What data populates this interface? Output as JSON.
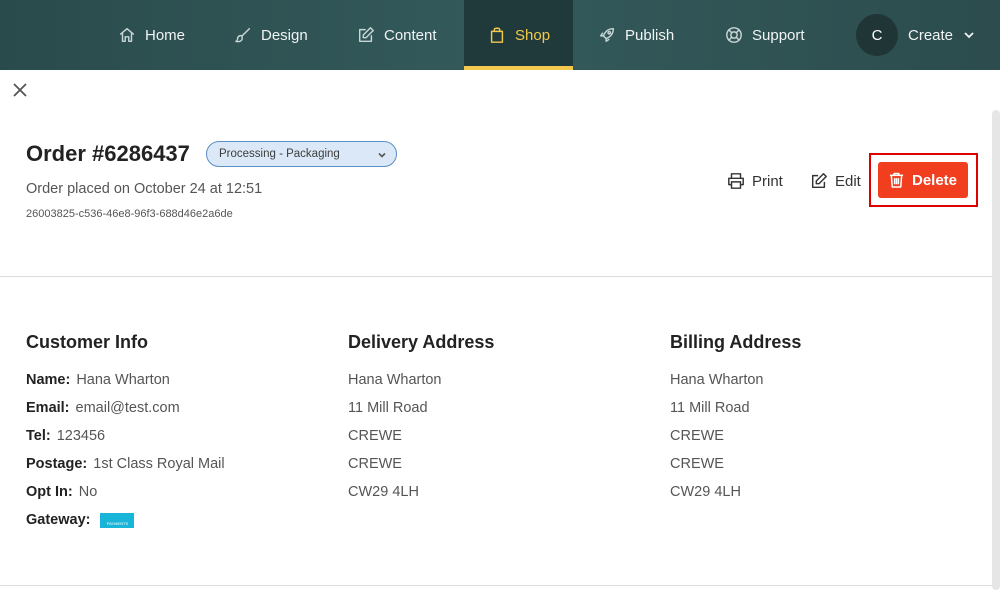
{
  "nav": {
    "items": [
      {
        "label": "Home",
        "icon": "home-icon"
      },
      {
        "label": "Design",
        "icon": "brush-icon"
      },
      {
        "label": "Content",
        "icon": "edit-icon"
      },
      {
        "label": "Shop",
        "icon": "shopping-bag-icon",
        "active": true
      },
      {
        "label": "Publish",
        "icon": "rocket-icon"
      },
      {
        "label": "Support",
        "icon": "lifebuoy-icon"
      }
    ],
    "avatar_initial": "C",
    "create_label": "Create"
  },
  "order": {
    "title": "Order #6286437",
    "status": "Processing - Packaging",
    "placed": "Order placed on October 24 at 12:51",
    "uuid": "26003825-c536-46e8-96f3-688d46e2a6de"
  },
  "actions": {
    "print_label": "Print",
    "edit_label": "Edit",
    "delete_label": "Delete"
  },
  "customer": {
    "heading": "Customer Info",
    "rows": [
      {
        "label": "Name:",
        "value": "Hana Wharton"
      },
      {
        "label": "Email:",
        "value": "email@test.com"
      },
      {
        "label": "Tel:",
        "value": "123456"
      },
      {
        "label": "Postage:",
        "value": "1st Class Royal Mail"
      },
      {
        "label": "Opt In:",
        "value": "No"
      },
      {
        "label": "Gateway:",
        "value": ""
      }
    ],
    "gateway_logo_text": "PAYMENTS"
  },
  "delivery": {
    "heading": "Delivery Address",
    "lines": [
      "Hana Wharton",
      "11 Mill Road",
      "CREWE",
      "CREWE",
      "CW29 4LH"
    ]
  },
  "billing": {
    "heading": "Billing Address",
    "lines": [
      "Hana Wharton",
      "11 Mill Road",
      "CREWE",
      "CREWE",
      "CW29 4LH"
    ]
  },
  "colors": {
    "nav_bg": "#345a5b",
    "nav_active": "#f2c94c",
    "delete_bg": "#f03e1f",
    "status_bg": "#dbe8f7"
  }
}
